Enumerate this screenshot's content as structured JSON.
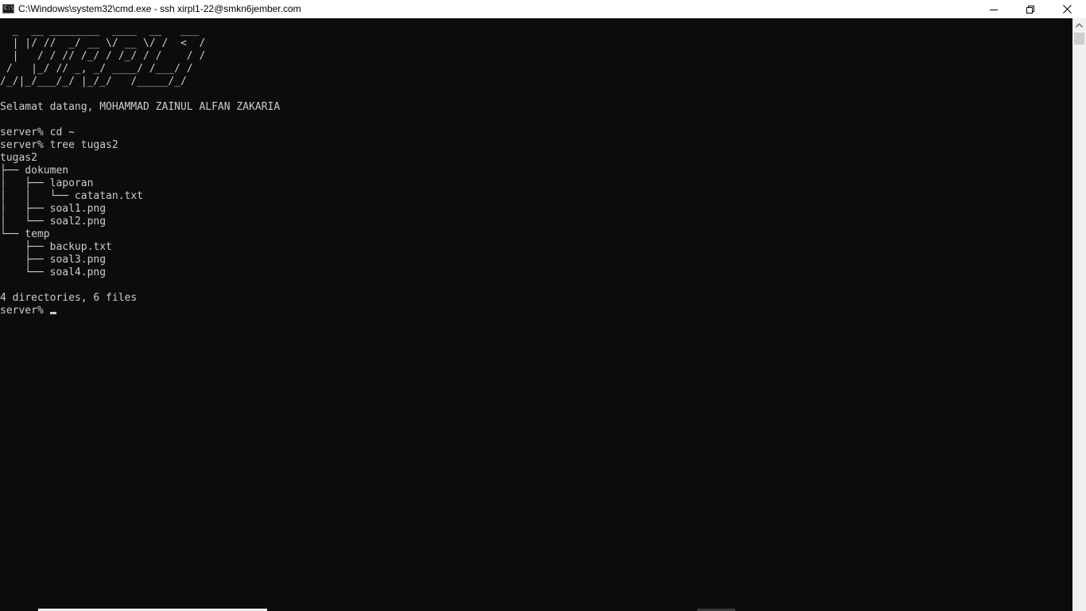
{
  "window": {
    "title": "C:\\Windows\\system32\\cmd.exe - ssh  xirpl1-22@smkn6jember.com",
    "icon": "cmd-console-icon",
    "icon_text": "C:\\",
    "controls": [
      "minimize-icon",
      "restore-icon",
      "close-icon"
    ]
  },
  "terminal": {
    "lines": [
      "  _  __ ________  ____  __   ___",
      "  | |/ //  _/ __ \\/ __ \\/ /  <  /",
      "  |   / / // /_/ / /_/ / /    / /",
      " /   |_/ // _, _/ ____/ /___/ /",
      "/_/|_/___/_/ |_/_/   /_____/_/",
      "",
      "Selamat datang, MOHAMMAD ZAINUL ALFAN ZAKARIA",
      "",
      "server% cd ~",
      "server% tree tugas2",
      "tugas2",
      "├── dokumen",
      "│   ├── laporan",
      "│   │   └── catatan.txt",
      "│   ├── soal1.png",
      "│   └── soal2.png",
      "└── temp",
      "    ├── backup.txt",
      "    ├── soal3.png",
      "    └── soal4.png",
      "",
      "4 directories, 6 files"
    ],
    "prompt": "server% ",
    "colors": {
      "background": "#0c0c0c",
      "foreground": "#cccccc"
    }
  },
  "scrollbar": {
    "up_icon": "scroll-up-arrow-icon"
  }
}
